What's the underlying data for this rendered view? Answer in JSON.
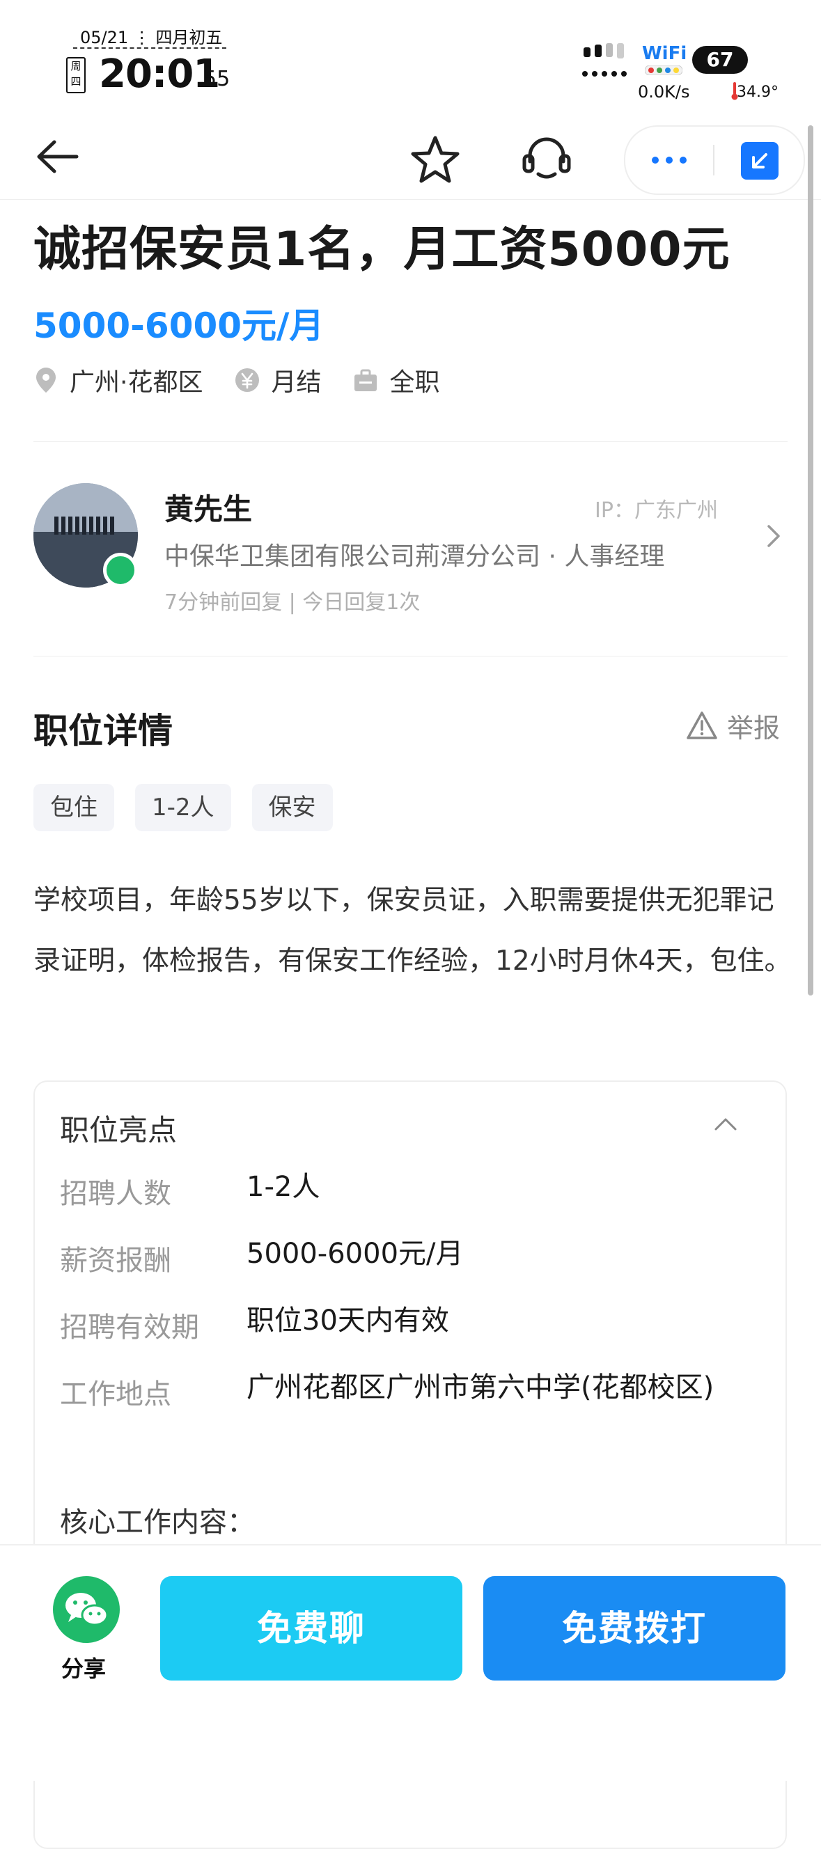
{
  "status_bar": {
    "date": "05/21",
    "lunar": "四月初五",
    "weekday": "周四",
    "time": "20:01",
    "seconds": "55",
    "wifi_label": "WiFi",
    "battery": "67",
    "net_speed": "0.0K/s",
    "temperature": "34.9°"
  },
  "nav": {
    "icons": [
      "back-arrow-icon",
      "star-icon",
      "customer-service-icon",
      "more-dots-icon",
      "minimize-icon"
    ]
  },
  "job": {
    "title": "诚招保安员1名，月工资5000元",
    "salary": "5000-6000元/月",
    "location": "广州·花都区",
    "pay_cycle": "月结",
    "job_type": "全职"
  },
  "recruiter": {
    "name": "黄先生",
    "ip": "IP：广东广州",
    "company": "中保华卫集团有限公司荊潭分公司 · 人事经理",
    "reply_info": "7分钟前回复 | 今日回复1次"
  },
  "details": {
    "section_title": "职位详情",
    "report_label": "举报",
    "chips": [
      "包住",
      "1-2人",
      "保安"
    ],
    "description": "学校项目，年龄55岁以下，保安员证，入职需要提供无犯罪记录证明，体检报告，有保安工作经验，12小时月休4天，包住。"
  },
  "highlights": {
    "title": "职位亮点",
    "rows": [
      {
        "label": "招聘人数",
        "value": "1-2人"
      },
      {
        "label": "薪资报酬",
        "value": "5000-6000元/月"
      },
      {
        "label": "招聘有效期",
        "value": "职位30天内有效"
      },
      {
        "label": "工作地点",
        "value": "广州花都区广州市第六中学(花都校区)"
      }
    ],
    "core_title": "核心工作内容："
  },
  "bottom_bar": {
    "share_label": "分享",
    "chat_button": "免费聊",
    "call_button": "免费拨打"
  },
  "colors": {
    "accent_blue": "#1a8cff",
    "chat_cyan": "#1ccbf3",
    "call_blue": "#1a8cf3",
    "online_green": "#1fba6a"
  }
}
